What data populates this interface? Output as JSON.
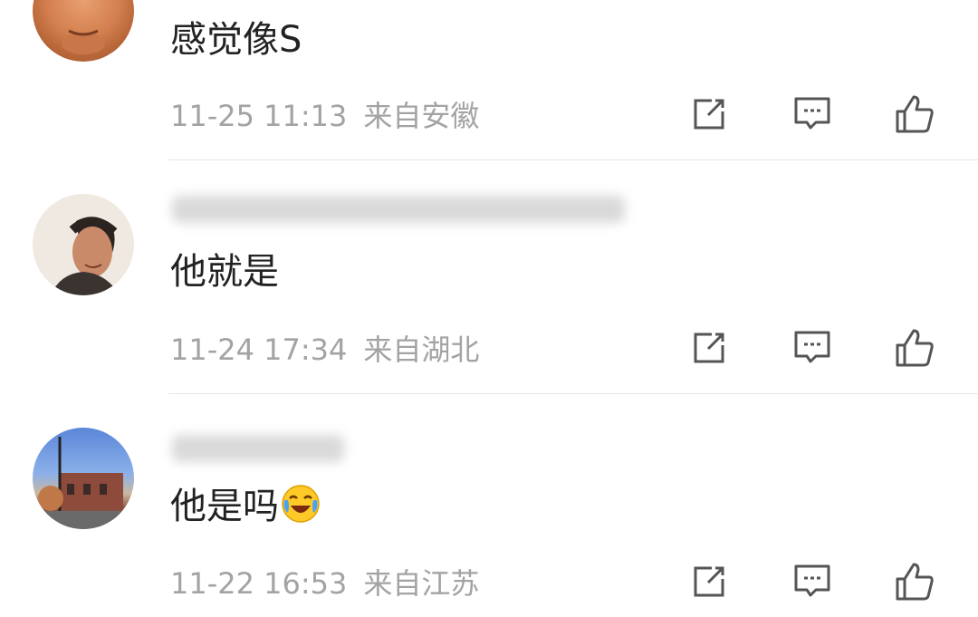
{
  "comments": [
    {
      "text": "感觉像S",
      "time": "11-25 11:13",
      "location": "来自安徽",
      "avatar": "person-face-avatar"
    },
    {
      "text": "他就是",
      "time": "11-24 17:34",
      "location": "来自湖北",
      "avatar": "smiling-man-avatar"
    },
    {
      "text": "他是吗",
      "emoji": "laughing-crying-emoji",
      "time": "11-22 16:53",
      "location": "来自江苏",
      "avatar": "street-building-avatar"
    }
  ],
  "icons": {
    "repost": "repost-icon",
    "comment": "comment-icon",
    "like": "thumbs-up-icon"
  },
  "colors": {
    "text": "#222222",
    "meta": "#a3a3a3",
    "icon": "#555555",
    "divider": "#e6e6e6"
  }
}
